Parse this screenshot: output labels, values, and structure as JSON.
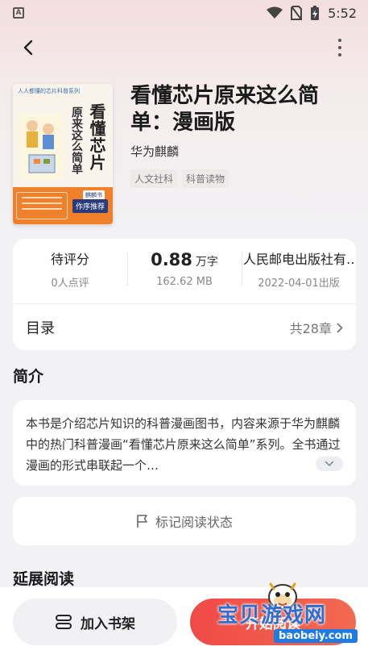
{
  "status_bar": {
    "notification_icon": "A",
    "time": "5:52"
  },
  "book": {
    "title": "看懂芯片原来这么简单：漫画版",
    "author": "华为麒麟",
    "tags": [
      "人文社科",
      "科普读物"
    ],
    "cover": {
      "series_text": "人人都懂的芯片科普系列",
      "title_main": "看懂芯片",
      "title_side": "原来这么简单",
      "badge_name": "麒麟书",
      "badge_text": "作序推荐"
    }
  },
  "stats": {
    "rating_label": "待评分",
    "rating_count": "0人点评",
    "word_count_value": "0.88",
    "word_count_unit": "万字",
    "file_size": "162.62 MB",
    "publisher": "人民邮电出版社有…",
    "publish_date": "2022-04-01出版"
  },
  "toc": {
    "label": "目录",
    "count": "共28章"
  },
  "intro": {
    "heading": "简介",
    "text": "本书是介绍芯片知识的科普漫画图书，内容来源于华为麒麟中的热门科普漫画“看懂芯片原来这么简单”系列。全书通过漫画的形式串联起一个…"
  },
  "mark": {
    "label": "标记阅读状态"
  },
  "extended": {
    "heading": "延展阅读"
  },
  "actions": {
    "shelf_label": "加入书架",
    "read_label": "开始阅读"
  },
  "watermark": {
    "text": "宝贝游戏网",
    "url": "baobeiy.com"
  },
  "colors": {
    "accent": "#f04a47",
    "watermark_blue": "#2d6fd0"
  }
}
